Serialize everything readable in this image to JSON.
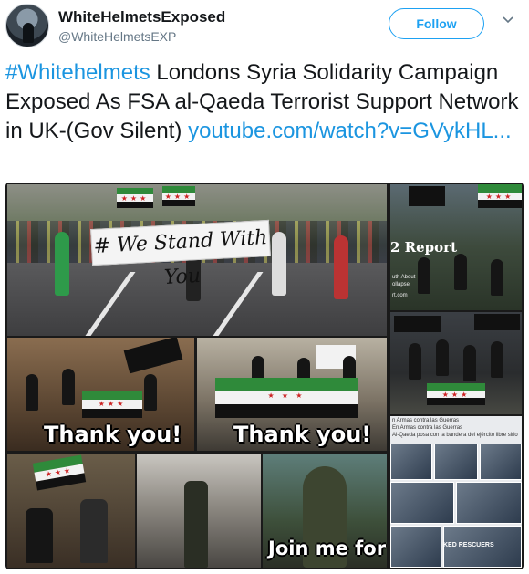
{
  "user": {
    "name": "WhiteHelmetsExposed",
    "handle": "@WhiteHelmetsEXP",
    "follow_label": "Follow"
  },
  "tweet": {
    "hashtag": "#Whitehelmets",
    "text": " Londons Syria Solidarity Campaign Exposed As FSA al-Qaeda Terrorist Support Network in UK-(Gov Silent) ",
    "link": "youtube.com/watch?v=GVykHL..."
  },
  "media": {
    "banner_text": "# We Stand With You",
    "report_label": "2 Report",
    "report_sub_1": "uth About",
    "report_sub_2": "ollapse",
    "report_sub_3": "rt.com",
    "doc_line_1": "n Armas contra las Guerras",
    "doc_line_2": "En Armas contra las Guerras",
    "doc_line_3": "Al-Qaeda posa con la bandera del ejército libre sirio",
    "rescuers_label": "KED RESCUERS",
    "thank_you_1": "Thank you!",
    "thank_you_2": "Thank you!",
    "join_text": "Join me for"
  },
  "colors": {
    "link": "#1b95e0",
    "follow": "#1da1f2",
    "handle": "#657786",
    "text": "#14171a"
  },
  "icons": {
    "caret": "chevron-down-icon"
  }
}
